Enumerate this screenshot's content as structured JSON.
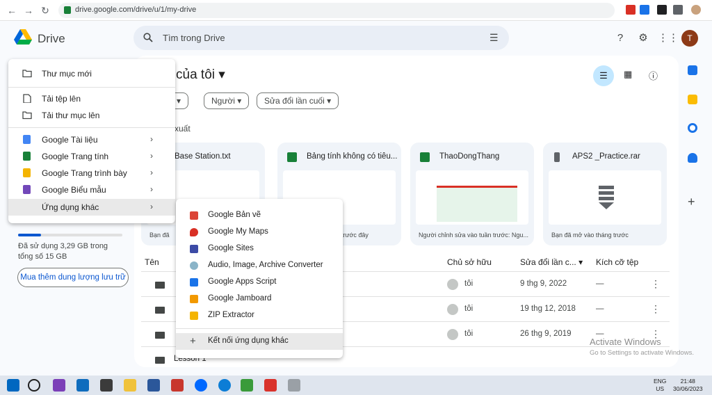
{
  "browser": {
    "url": "drive.google.com/drive/u/1/my-drive",
    "back_icon": "←",
    "forward_icon": "→",
    "reload_icon": "↻"
  },
  "header": {
    "app_name": "Drive",
    "search_placeholder": "Tìm trong Drive",
    "avatar_letter": "T"
  },
  "main": {
    "title": "của tôi ▾",
    "chips": [
      "p ▾",
      "Người ▾",
      "Sửa đổi lần cuối ▾"
    ],
    "suggested_label": "xuất",
    "cards": [
      {
        "title": "Base Station.txt",
        "footer": "Bạn đã",
        "icon_color": "#ffffff"
      },
      {
        "title": "Bảng tính không có tiêu...",
        "footer": "trước đây",
        "icon_color": "#188038"
      },
      {
        "title": "ThaoDongThang",
        "footer": "Người chỉnh sửa vào tuần trước: Ngu...",
        "icon_color": "#188038"
      },
      {
        "title": "APS2 _Practice.rar",
        "footer": "Bạn đã mở vào tháng trước",
        "icon_color": "#5f6368"
      }
    ],
    "list_headers": {
      "name": "Tên",
      "owner": "Chủ sở hữu",
      "modified": "Sửa đổi lần c... ▾",
      "size": "Kích cỡ tệp"
    },
    "rows": [
      {
        "owner": "tôi",
        "modified": "9 thg 9, 2022",
        "size": "—"
      },
      {
        "owner": "tôi",
        "modified": "19 thg 12, 2018",
        "size": "—"
      },
      {
        "owner": "tôi",
        "modified": "26 thg 9, 2019",
        "size": "—"
      }
    ],
    "last_row_name": "Lesson 1"
  },
  "sidebar": {
    "storage_text": "Đã sử dụng 3,29 GB trong tổng số 15 GB",
    "storage_fraction": 0.22,
    "buy_storage": "Mua thêm dung lượng lưu trữ"
  },
  "new_menu": {
    "items": [
      {
        "label": "Thư mục mới",
        "icon": "new-folder-icon"
      },
      {
        "label": "Tải tệp lên",
        "icon": "upload-file-icon"
      },
      {
        "label": "Tải thư mục lên",
        "icon": "upload-folder-icon"
      },
      {
        "label": "Google Tài liệu",
        "icon": "docs-icon",
        "color": "#4285f4"
      },
      {
        "label": "Google Trang tính",
        "icon": "sheets-icon",
        "color": "#188038"
      },
      {
        "label": "Google Trang trình bày",
        "icon": "slides-icon",
        "color": "#f4b400"
      },
      {
        "label": "Google Biểu mẫu",
        "icon": "forms-icon",
        "color": "#7248b9"
      },
      {
        "label": "Ứng dụng khác"
      }
    ]
  },
  "sub_menu": {
    "items": [
      {
        "label": "Google Bản vẽ",
        "color": "#db4437"
      },
      {
        "label": "Google My Maps",
        "color": "#d93025"
      },
      {
        "label": "Google Sites",
        "color": "#3c4ba6"
      },
      {
        "label": "Audio, Image, Archive Converter",
        "color": "#8ab4c8"
      },
      {
        "label": "Google Apps Script",
        "color": "#1a73e8"
      },
      {
        "label": "Google Jamboard",
        "color": "#f29900"
      },
      {
        "label": "ZIP Extractor",
        "color": "#f4b400"
      },
      {
        "label": "Kết nối ứng dụng khác",
        "icon": "+"
      }
    ]
  },
  "watermark": {
    "line1": "Activate Windows",
    "line2": "Go to Settings to activate Windows."
  },
  "taskbar": {
    "lang": "ENG\nUS",
    "time": "21:48",
    "date": "30/06/2023"
  }
}
